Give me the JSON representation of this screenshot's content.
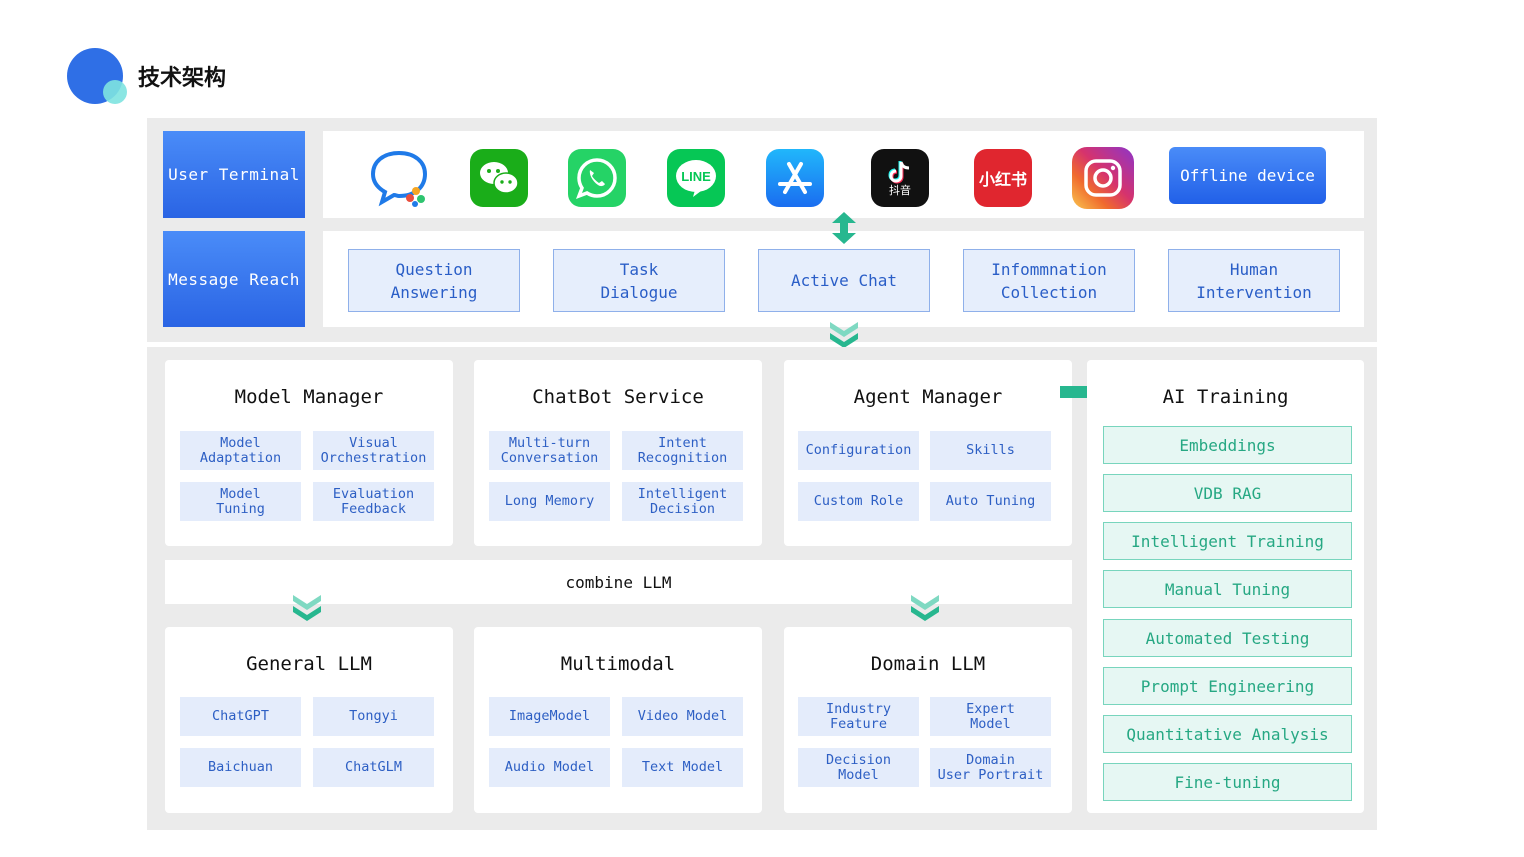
{
  "header": {
    "title": "技术架构"
  },
  "top": {
    "user_terminal_label": "User Terminal",
    "message_reach_label": "Message Reach",
    "offline_device_label": "Offline device",
    "apps": [
      {
        "name": "qq-chat-icon",
        "color": "#2b8af0"
      },
      {
        "name": "wechat-icon",
        "color": "#1aad19"
      },
      {
        "name": "whatsapp-icon",
        "color": "#25d366"
      },
      {
        "name": "line-icon",
        "color": "#06c755",
        "text": "LINE"
      },
      {
        "name": "app-store-icon",
        "color": "#1c8cf4"
      },
      {
        "name": "douyin-icon",
        "color": "#111111",
        "text": "抖音"
      },
      {
        "name": "xiaohongshu-icon",
        "color": "#e0262f",
        "text": "小红书"
      },
      {
        "name": "instagram-icon",
        "color": "#d6336c"
      }
    ],
    "reach_items": [
      "Question\nAnswering",
      "Task\nDialogue",
      "Active Chat",
      "Infommnation\nCollection",
      "Human\nIntervention"
    ]
  },
  "cards": {
    "model_manager": {
      "title": "Model Manager",
      "chips": [
        "Model\nAdaptation",
        "Visual\nOrchestration",
        "Model\nTuning",
        "Evaluation\nFeedback"
      ]
    },
    "chatbot_service": {
      "title": "ChatBot Service",
      "chips": [
        "Multi-turn\nConversation",
        "Intent\nRecognition",
        "Long Memory",
        "Intelligent\nDecision"
      ]
    },
    "agent_manager": {
      "title": "Agent Manager",
      "chips": [
        "Configuration",
        "Skills",
        "Custom Role",
        "Auto Tuning"
      ]
    },
    "combine_label": "combine LLM",
    "general_llm": {
      "title": "General LLM",
      "chips": [
        "ChatGPT",
        "Tongyi",
        "Baichuan",
        "ChatGLM"
      ]
    },
    "multimodal": {
      "title": "Multimodal",
      "chips": [
        "ImageModel",
        "Video Model",
        "Audio Model",
        "Text Model"
      ]
    },
    "domain_llm": {
      "title": "Domain LLM",
      "chips": [
        "Industry\nFeature",
        "Expert\nModel",
        "Decision\nModel",
        "Domain\nUser Portrait"
      ]
    }
  },
  "ai_training": {
    "title": "AI Training",
    "items": [
      "Embeddings",
      "VDB RAG",
      "Intelligent Training",
      "Manual Tuning",
      "Automated Testing",
      "Prompt Engineering",
      "Quantitative Analysis",
      "Fine-tuning"
    ]
  },
  "colors": {
    "accent_blue": "#2f6fe6",
    "accent_green": "#2ec4a0",
    "chip_blue": "#e4ecfb",
    "panel_gray": "#ebebeb"
  }
}
